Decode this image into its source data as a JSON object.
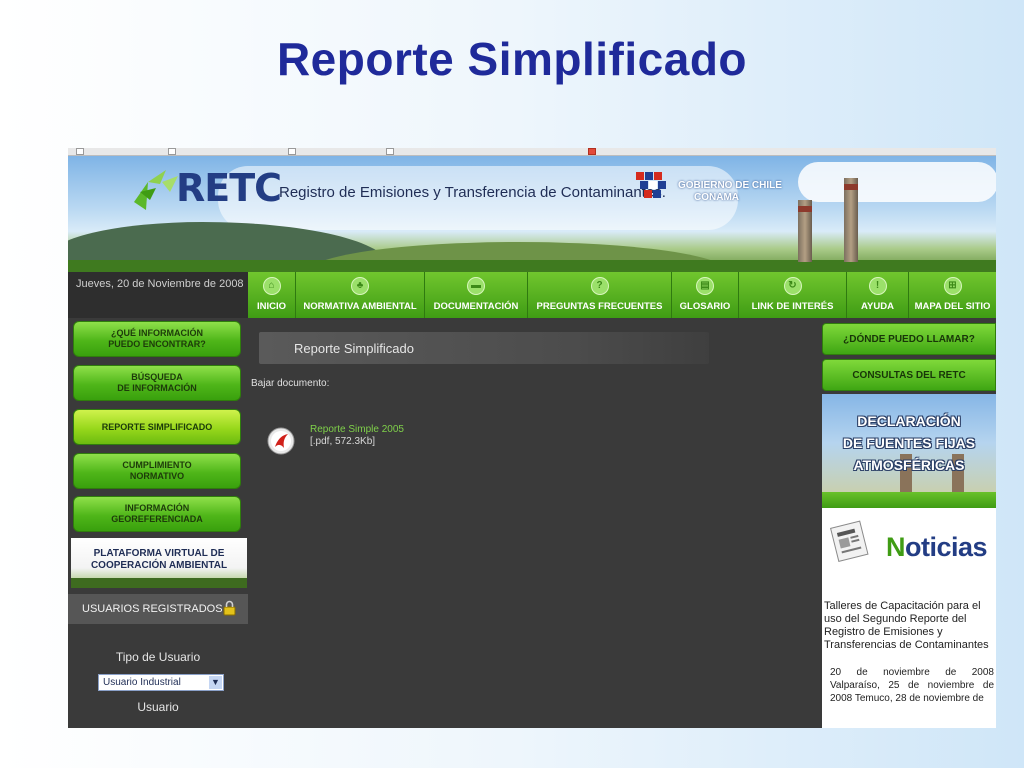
{
  "slide": {
    "title": "Reporte Simplificado"
  },
  "banner": {
    "logo_text": "RETC",
    "subtitle": "Registro de Emisiones y Transferencia de Contaminantes.",
    "gov_line1": "GOBIERNO DE CHILE",
    "gov_line2": "CONAMA"
  },
  "date": "Jueves, 20 de Noviembre de 2008",
  "nav": {
    "items": [
      {
        "label": "INICIO",
        "icon": "home-icon"
      },
      {
        "label": "NORMATIVA AMBIENTAL",
        "icon": "leaf-icon"
      },
      {
        "label": "DOCUMENTACIÓN",
        "icon": "folder-icon"
      },
      {
        "label": "PREGUNTAS FRECUENTES",
        "icon": "question-icon"
      },
      {
        "label": "GLOSARIO",
        "icon": "book-icon"
      },
      {
        "label": "LINK DE INTERÉS",
        "icon": "link-icon"
      },
      {
        "label": "AYUDA",
        "icon": "help-icon"
      },
      {
        "label": "MAPA DEL SITIO",
        "icon": "sitemap-icon"
      }
    ]
  },
  "left_menu": {
    "items": [
      {
        "label": "¿QUÉ INFORMACIÓN\nPUEDO ENCONTRAR?"
      },
      {
        "label": "BÚSQUEDA\nDE INFORMACIÓN"
      },
      {
        "label": "REPORTE SIMPLIFICADO"
      },
      {
        "label": "CUMPLIMIENTO\nNORMATIVO"
      },
      {
        "label": "INFORMACIÓN\nGEOREFERENCIADA"
      }
    ],
    "platform": "PLATAFORMA VIRTUAL DE\nCOOPERACIÓN AMBIENTAL",
    "users_title": "USUARIOS REGISTRADOS",
    "tipo_label": "Tipo de Usuario",
    "tipo_value": "Usuario Industrial",
    "usuario_label": "Usuario"
  },
  "main": {
    "header": "Reporte Simplificado",
    "bajar": "Bajar documento:",
    "doc_title": "Reporte Simple 2005",
    "doc_meta": "[.pdf, 572.3Kb]"
  },
  "right": {
    "btn1": "¿DÓNDE PUEDO LLAMAR?",
    "btn2": "CONSULTAS DEL RETC",
    "declaracion": "DECLARACIÓN\nDE FUENTES FIJAS\nATMOSFÉRICAS",
    "noticias_first": "N",
    "noticias_rest": "oticias",
    "news_title": "Talleres de Capacitación para el uso del Segundo Reporte del Registro de Emisiones y Transferencias de Contaminantes",
    "news_body": "20 de noviembre de 2008 Valparaíso, 25 de noviembre de 2008 Temuco, 28 de noviembre de"
  }
}
